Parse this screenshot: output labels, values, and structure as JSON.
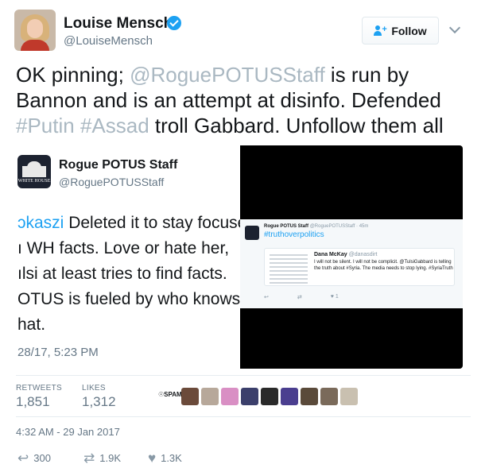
{
  "header": {
    "name": "Louise Mensch",
    "handle": "@LouiseMensch",
    "follow_label": "Follow"
  },
  "tweet": {
    "parts": [
      {
        "text": "OK pinning; ",
        "link": false
      },
      {
        "text": "@RoguePOTUSStaff",
        "link": true
      },
      {
        "text": " is run by Bannon and is an attempt at disinfo. Defended ",
        "link": false
      },
      {
        "text": "#Putin",
        "link": true
      },
      {
        "text": " ",
        "link": false
      },
      {
        "text": "#Assad",
        "link": true
      },
      {
        "text": " troll Gabbard. Unfollow them all",
        "link": false
      }
    ]
  },
  "embed": {
    "name": "Rogue POTUS Staff",
    "handle": "@RoguePOTUSStaff",
    "logo_caption": "WHITE HOUSE",
    "lines": [
      {
        "mention": "ɔkaszi",
        "text": " Deleted it to stay focuse"
      },
      {
        "mention": "",
        "text": "ı WH facts. Love or hate her,"
      },
      {
        "mention": "",
        "text": "ılsi at least tries to find facts."
      },
      {
        "mention": "",
        "text": "OTUS is fueled by who knows"
      },
      {
        "mention": "",
        "text": "hat."
      }
    ],
    "time": "28/17, 5:23 PM",
    "inner": {
      "name": "Rogue POTUS Staff",
      "meta": "@RoguePOTUSStaff · 45m",
      "hashtag": "#truthoverpolitics",
      "quoted_name": "Dana McKay",
      "quoted_handle": "@danasdirt",
      "quoted_text": "I will not be silent. I will not be complicit. @TulsiGabbard is telling the truth about #Syria. The media needs to stop lying. #SyriaTruth"
    }
  },
  "stats": {
    "retweets_label": "RETWEETS",
    "retweets_value": "1,851",
    "likes_label": "LIKES",
    "likes_value": "1,312",
    "spam_label": "☉SPAM"
  },
  "likers": [
    "#6b4a3a",
    "#b7a89a",
    "#d98fc4",
    "#3b3f6b",
    "#2a2a2a",
    "#4a3e8f",
    "#5a4a3a",
    "#7a6a5a",
    "#c9c0b0"
  ],
  "timestamp": "4:32 AM - 29 Jan 2017",
  "actions": {
    "reply_count": "300",
    "retweet_count": "1.9K",
    "like_count": "1.3K"
  }
}
